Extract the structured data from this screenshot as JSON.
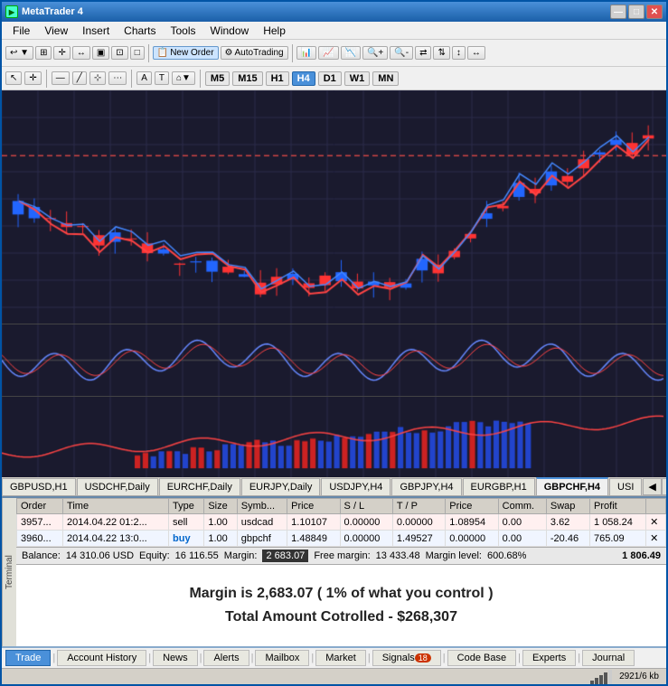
{
  "window": {
    "title": "MetaTrader 4",
    "icon": "MT"
  },
  "menubar": {
    "items": [
      "File",
      "View",
      "Insert",
      "Charts",
      "Tools",
      "Window",
      "Help"
    ]
  },
  "toolbar1": {
    "buttons": [
      "new_order",
      "autotrade"
    ],
    "new_order_label": "New Order",
    "autotrade_label": "AutoTrading"
  },
  "toolbar2": {
    "timeframes": [
      "M5",
      "M15",
      "H1",
      "H4",
      "D1",
      "W1",
      "MN"
    ],
    "active_tf": "H4"
  },
  "chart_tabs": {
    "tabs": [
      {
        "id": "gbpusd",
        "label": "GBPUSD,H1"
      },
      {
        "id": "usdchf",
        "label": "USDCHF,Daily"
      },
      {
        "id": "eurchf",
        "label": "EURCHF,Daily"
      },
      {
        "id": "eurjpy",
        "label": "EURJPY,Daily"
      },
      {
        "id": "usdjpy",
        "label": "USDJPY,H4"
      },
      {
        "id": "gbpjpy",
        "label": "GBPJPY,H4"
      },
      {
        "id": "eurgbp",
        "label": "EURGBP,H1"
      },
      {
        "id": "gbpchf",
        "label": "GBPCHF,H4",
        "active": true
      },
      {
        "id": "usi",
        "label": "USI"
      }
    ]
  },
  "terminal_table": {
    "headers": [
      "Order",
      "Time",
      "Type",
      "Size",
      "Symb...",
      "Price",
      "S / L",
      "T / P",
      "Price",
      "Comm.",
      "Swap",
      "Profit"
    ],
    "rows": [
      {
        "type": "sell",
        "order": "3957...",
        "time": "2014.04.22 01:2...",
        "trade_type": "sell",
        "size": "1.00",
        "symbol": "usdcad",
        "open_price": "1.10107",
        "sl": "0.00000",
        "tp": "0.00000",
        "price": "1.08954",
        "comm": "0.00",
        "swap": "3.62",
        "profit": "1 058.24"
      },
      {
        "type": "buy",
        "order": "3960...",
        "time": "2014.04.22 13:0...",
        "trade_type": "buy",
        "size": "1.00",
        "symbol": "gbpchf",
        "open_price": "1.48849",
        "sl": "0.00000",
        "tp": "1.49527",
        "price": "0.00000",
        "comm": "0.00",
        "swap": "-20.46",
        "profit": "765.09"
      }
    ]
  },
  "balance_bar": {
    "balance_label": "Balance:",
    "balance_value": "14 310.06 USD",
    "equity_label": "Equity:",
    "equity_value": "16 116.55",
    "margin_label": "Margin:",
    "margin_value": "2 683.07",
    "free_margin_label": "Free margin:",
    "free_margin_value": "13 433.48",
    "margin_level_label": "Margin level:",
    "margin_level_value": "600.68%",
    "right_value": "1 806.49"
  },
  "info_text": {
    "line1": "Margin is 2,683.07   ( 1% of what you control )",
    "line2": "Total Amount Cotrolled - $268,307"
  },
  "bottom_tabs": {
    "tabs": [
      {
        "label": "Trade",
        "active": true
      },
      {
        "label": "Account History"
      },
      {
        "label": "News"
      },
      {
        "label": "Alerts"
      },
      {
        "label": "Mailbox"
      },
      {
        "label": "Market"
      },
      {
        "label": "Signals",
        "badge": "18"
      },
      {
        "label": "Code Base"
      },
      {
        "label": "Experts"
      },
      {
        "label": "Journal"
      }
    ]
  },
  "status_bar": {
    "value": "2921/6 kb"
  }
}
